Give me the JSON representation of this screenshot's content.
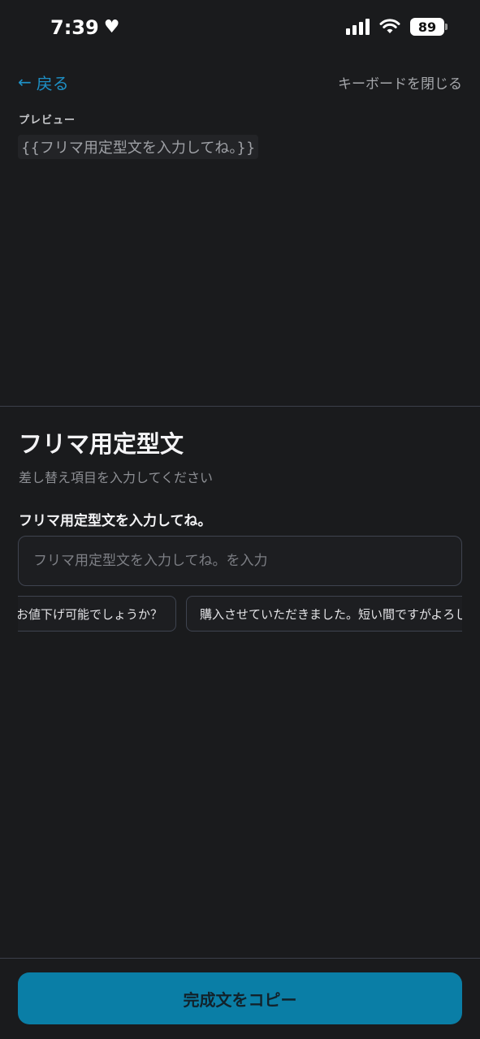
{
  "status_bar": {
    "time": "7:39",
    "battery": "89"
  },
  "nav": {
    "back_label": "戻る",
    "close_keyboard_label": "キーボードを閉じる"
  },
  "preview": {
    "label": "プレビュー",
    "text": "{{フリマ用定型文を入力してね。}}"
  },
  "form": {
    "title": "フリマ用定型文",
    "subtitle": "差し替え項目を入力してください",
    "field_label": "フリマ用定型文を入力してね。",
    "field_placeholder": "フリマ用定型文を入力してね。を入力",
    "field_value": ""
  },
  "suggestions": [
    "お値下げ可能でしょうか？",
    "購入させていただきました。短い間ですがよろしくお願いします。"
  ],
  "footer": {
    "copy_button_label": "完成文をコピー"
  },
  "colors": {
    "background": "#1a1b1d",
    "accent": "#1e8fc4",
    "button": "#0a7ea6"
  }
}
